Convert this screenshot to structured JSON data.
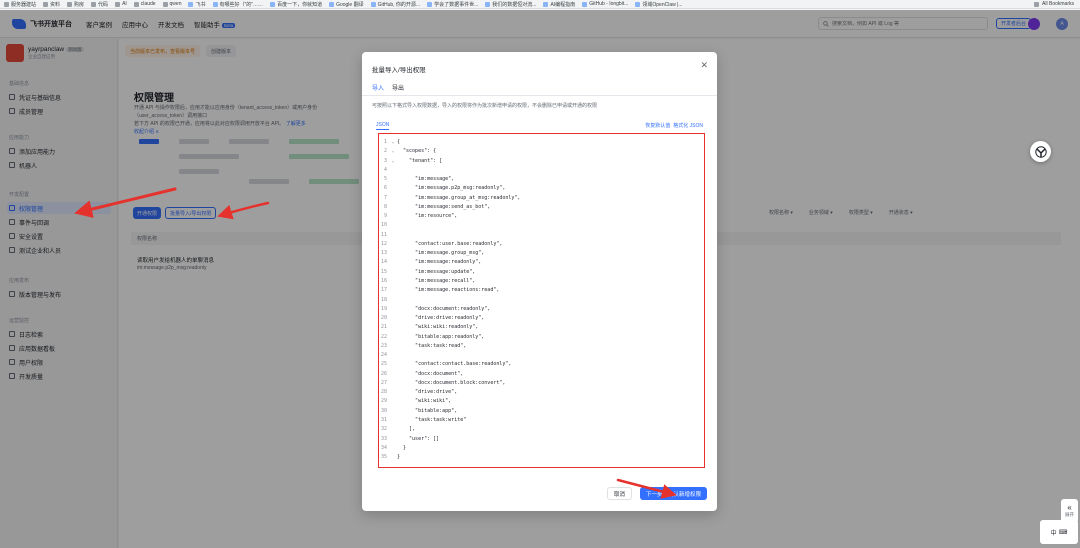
{
  "bookmarks": [
    "服务器建站",
    "资料",
    "购房",
    "代码",
    "AI",
    "claude",
    "qwen",
    "飞书",
    "有哪些好（\"的\"……",
    "百度一下，你就知道",
    "Google 翻译",
    "GitHub, 你的开源...",
    "学会了数据事件世...",
    "我们的数据恒对流...",
    "AI编程指南",
    "GitHub - Iongbit...",
    "领域OpenClaw |..."
  ],
  "bookmarks_right": "All Bookmarks",
  "topnav": {
    "brand": "飞书开放平台",
    "items": [
      "客户案例",
      "应用中心",
      "开发文档",
      "智能助手"
    ],
    "beta": "Beta",
    "search_placeholder": "搜索文档，例如 API 或 Log 等",
    "docs_button": "开发者后台",
    "avatar": "A"
  },
  "sidebar": {
    "app_name": "yayrpanclaw",
    "app_tag": "测试版",
    "app_sub": "企业自建应用",
    "groups": [
      {
        "label": "基础信息",
        "items": [
          {
            "label": "凭证与基础信息"
          },
          {
            "label": "成员管理"
          }
        ]
      },
      {
        "label": "应用能力",
        "items": [
          {
            "label": "添加应用能力"
          },
          {
            "label": "机器人"
          }
        ]
      },
      {
        "label": "开发配置",
        "items": [
          {
            "label": "权限管理",
            "active": true
          },
          {
            "label": "事件与回调"
          },
          {
            "label": "安全设置"
          },
          {
            "label": "测试企业和人员"
          }
        ]
      },
      {
        "label": "应用发布",
        "items": [
          {
            "label": "版本管理与发布"
          }
        ]
      },
      {
        "label": "运营监控",
        "items": [
          {
            "label": "日志检索"
          },
          {
            "label": "应用数据看板"
          },
          {
            "label": "用户权限"
          },
          {
            "label": "开发质量"
          }
        ]
      }
    ]
  },
  "main": {
    "publish_pills": [
      "当前版本已发布，查看版本号",
      "创建版本"
    ],
    "title": "权限管理",
    "desc_1": "开通 API 与操作权限后，应用才能以应用身份（tenant_access_token）或用户身份（user_access_token）调用接口",
    "desc_2": "若下方 API 的权限已开通，应用将以此对应权限调用开放平台 API。",
    "desc_link": "了解更多",
    "desc_more": "收起介绍 ∧",
    "tab_buttons": [
      "开通权限",
      "批量导入/导出权限"
    ],
    "filters": [
      "权限名称 ▾",
      "业务领域 ▾",
      "权限类型 ▾",
      "开通状态 ▾"
    ],
    "table_head": "权限名称",
    "row_title": "读取用户发给机器人的单聊消息",
    "row_sub": "im:message.p2p_msg:readonly"
  },
  "modal": {
    "title": "批量导入/导出权限",
    "tabs": [
      "导入",
      "导出"
    ],
    "description": "可按照以下格式导入权限数据，导入的权限将作为批次新增申请的权限，不会删除已申请或开通的权限",
    "json_label": "JSON",
    "json_actions": [
      "恢复默认值",
      "格式化 JSON"
    ],
    "code_lines": [
      "{",
      "  \"scopes\": {",
      "    \"tenant\": [",
      "",
      "      \"im:message\",",
      "      \"im:message.p2p_msg:readonly\",",
      "      \"im:message.group_at_msg:readonly\",",
      "      \"im:message:send_as_bot\",",
      "      \"im:resource\",",
      "",
      "",
      "      \"contact:user.base:readonly\",",
      "      \"im:message.group_msg\",",
      "      \"im:message:readonly\",",
      "      \"im:message:update\",",
      "      \"im:message:recall\",",
      "      \"im:message.reactions:read\",",
      "",
      "      \"docx:document:readonly\",",
      "      \"drive:drive:readonly\",",
      "      \"wiki:wiki:readonly\",",
      "      \"bitable:app:readonly\",",
      "      \"task:task:read\",",
      "",
      "      \"contact:contact.base:readonly\",",
      "      \"docx:document\",",
      "      \"docx:document.block:convert\",",
      "      \"drive:drive\",",
      "      \"wiki:wiki\",",
      "      \"bitable:app\",",
      "      \"task:task:write\"",
      "    ],",
      "    \"user\": []",
      "  }",
      "}"
    ],
    "fold_lines": [
      1,
      2,
      3
    ],
    "cancel_label": "取消",
    "next_label": "下一步，确认新增权限"
  },
  "floating": {
    "expand_label": "展开",
    "ime_label": "中"
  },
  "colors": {
    "accent": "#3370ff",
    "annotation_red": "#e5322d"
  }
}
